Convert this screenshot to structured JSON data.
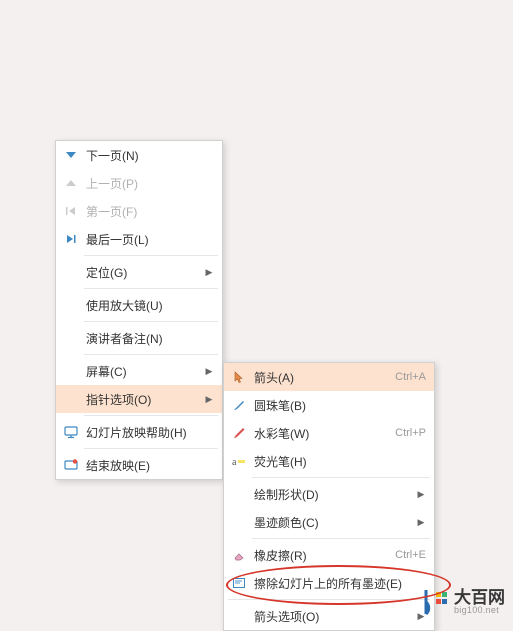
{
  "main_menu": {
    "next_page": "下一页(N)",
    "prev_page": "上一页(P)",
    "first_page": "第一页(F)",
    "last_page": "最后一页(L)",
    "goto": "定位(G)",
    "magnifier": "使用放大镜(U)",
    "speaker_notes": "演讲者备注(N)",
    "screen": "屏幕(C)",
    "pointer_options": "指针选项(O)",
    "slideshow_help": "幻灯片放映帮助(H)",
    "end_show": "结束放映(E)"
  },
  "sub_menu": {
    "arrow": "箭头(A)",
    "arrow_shortcut": "Ctrl+A",
    "ballpoint": "圆珠笔(B)",
    "watercolor": "水彩笔(W)",
    "watercolor_shortcut": "Ctrl+P",
    "highlighter": "荧光笔(H)",
    "draw_shape": "绘制形状(D)",
    "ink_color": "墨迹颜色(C)",
    "eraser": "橡皮擦(R)",
    "eraser_shortcut": "Ctrl+E",
    "erase_all": "擦除幻灯片上的所有墨迹(E)",
    "arrow_options": "箭头选项(O)"
  },
  "watermark": {
    "main": "大百网",
    "sub": "big100.net"
  }
}
